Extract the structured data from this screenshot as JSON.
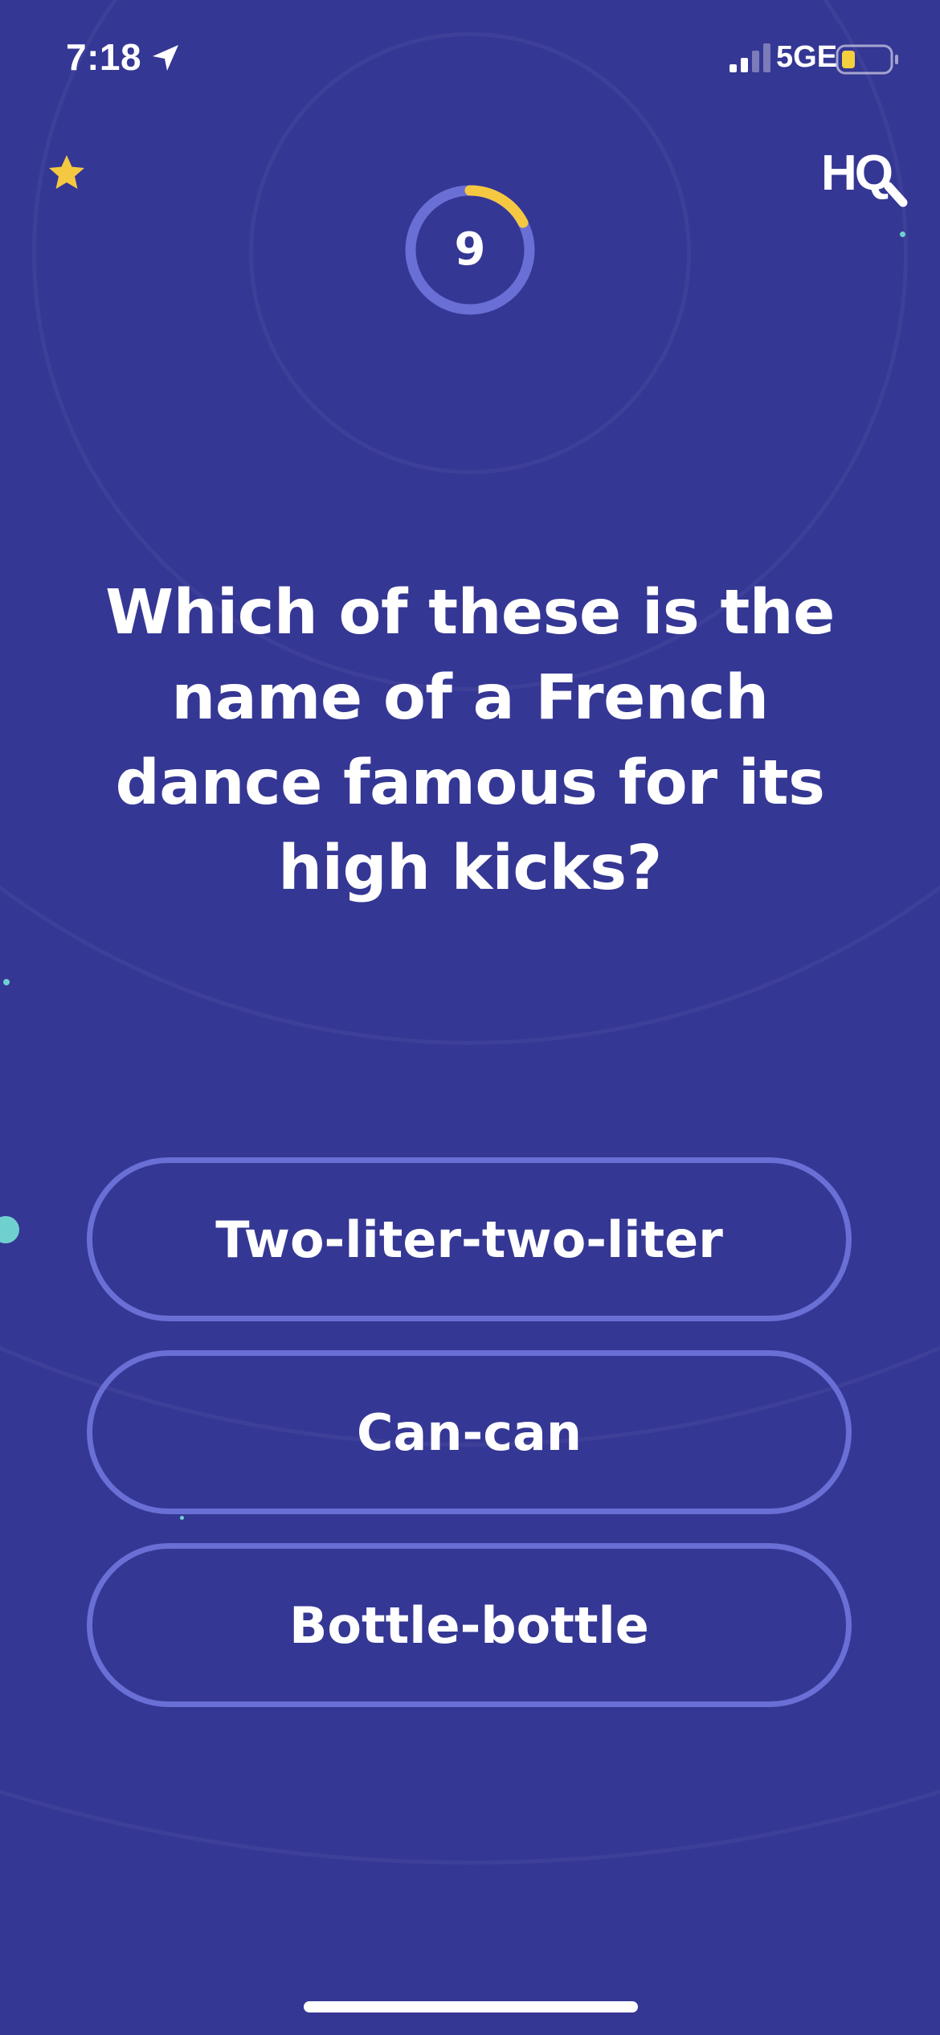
{
  "status_bar": {
    "time": "7:18",
    "network": "5GE",
    "icons": {
      "location": "location-arrow-icon",
      "signal": "cellular-signal-icon",
      "battery": "battery-low-icon"
    },
    "battery_color": "#f4d03f"
  },
  "header": {
    "left_icon": "star-icon",
    "logo_text": "HQ",
    "star_color": "#f5c842"
  },
  "timer": {
    "value": "9",
    "arc_color": "#f5c842",
    "track_color": "#6a6fd6"
  },
  "question": {
    "text": "Which of these is the name of a French dance famous for its high kicks?"
  },
  "answers": [
    {
      "label": "Two-liter-two-liter"
    },
    {
      "label": "Can-can"
    },
    {
      "label": "Bottle-bottle"
    }
  ],
  "colors": {
    "background": "#353794",
    "answer_border": "#6a6fd6",
    "accent": "#f5c842"
  }
}
